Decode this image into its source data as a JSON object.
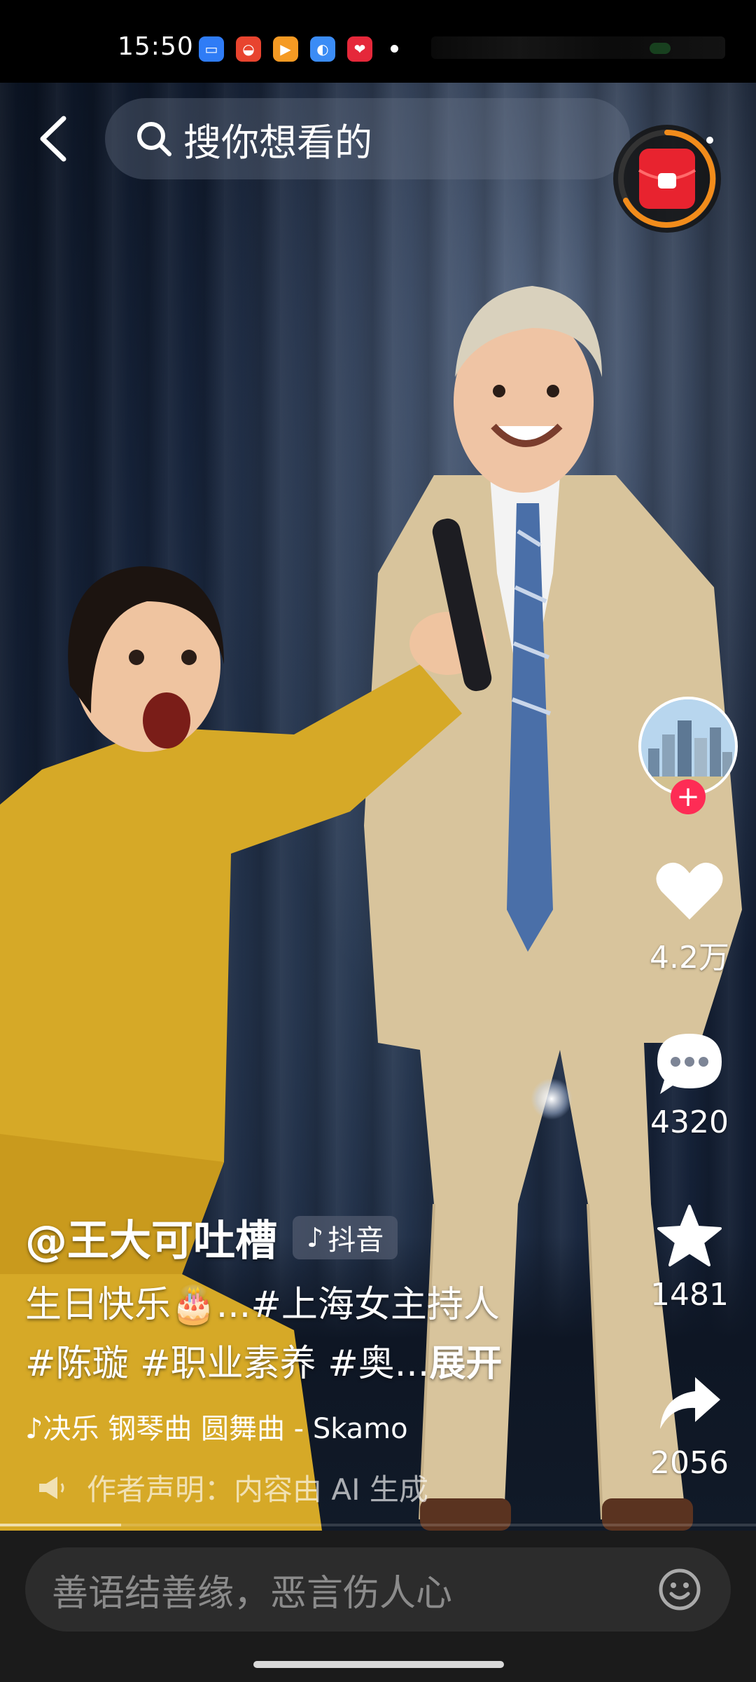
{
  "status_bar": {
    "time": "15:50",
    "app_icons": [
      {
        "name": "blue-app-icon",
        "color": "#2f7cf6",
        "glyph": "▭"
      },
      {
        "name": "red-app-icon",
        "color": "#e8442f",
        "glyph": "◒"
      },
      {
        "name": "orange-video-icon",
        "color": "#f59a23",
        "glyph": "▶"
      },
      {
        "name": "blue-browser-icon",
        "color": "#3b8cf5",
        "glyph": "◐"
      },
      {
        "name": "red-heart-app-icon",
        "color": "#e5283a",
        "glyph": "❤"
      }
    ]
  },
  "header": {
    "back_icon": "chevron-left-icon",
    "search_placeholder": "搜你想看的"
  },
  "actions": {
    "likes": "4.2万",
    "comments": "4320",
    "favorites": "1481",
    "shares": "2056"
  },
  "post": {
    "author": "@王大可吐槽",
    "platform_tag": "抖音",
    "caption_line1": "生日快乐🎂...#上海女主持人",
    "caption_line2_tags": "#陈璇 #职业素养 #奥...",
    "expand_label": "展开",
    "music": "♪决乐 钢琴曲 圆舞曲 - Skamo",
    "disclaimer": "作者声明：内容由 AI 生成"
  },
  "progress": {
    "fraction": 0.16
  },
  "comment_bar": {
    "placeholder": "善语结善缘，恶言伤人心"
  },
  "colors": {
    "accent": "#fe2c55",
    "ring": "#f28c1b",
    "redpack": "#e8232f"
  }
}
